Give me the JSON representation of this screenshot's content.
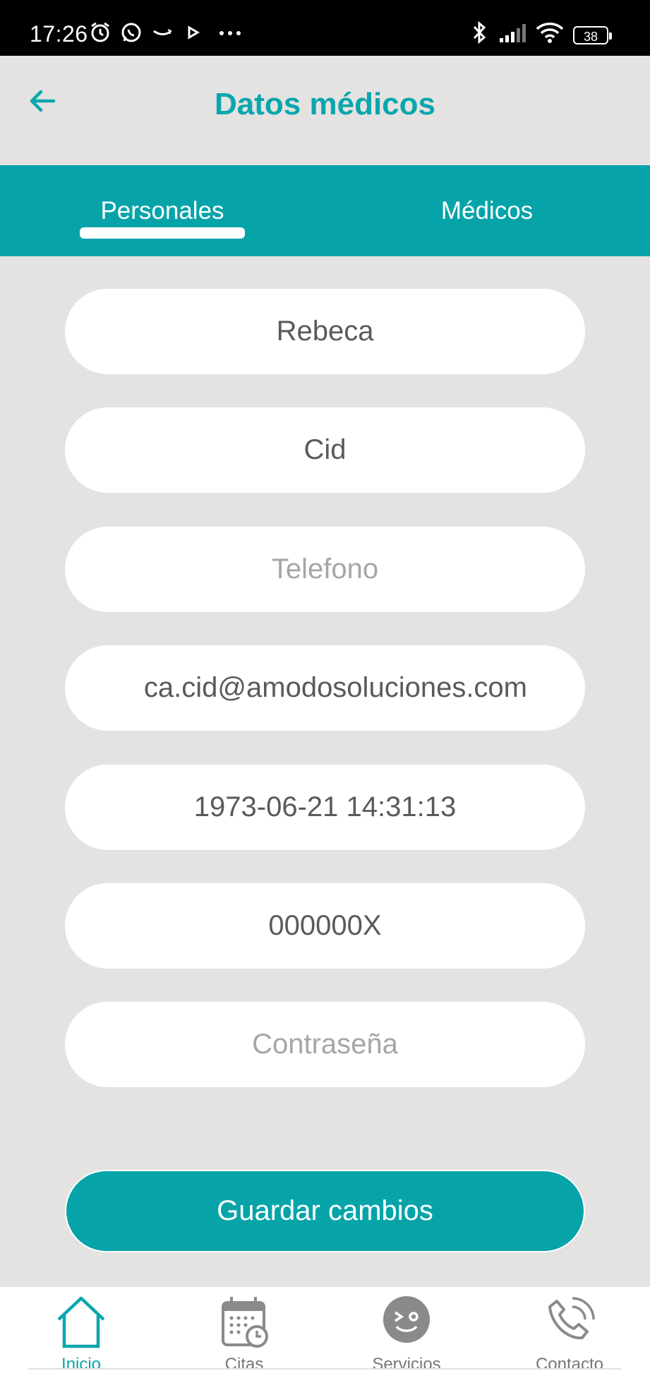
{
  "status_bar": {
    "time": "17:26",
    "battery": "38",
    "left_icons": [
      "alarm-icon",
      "whatsapp-icon",
      "amazon-icon",
      "play-icon",
      "more-dots-icon"
    ],
    "right_icons": [
      "bluetooth-icon",
      "signal-icon",
      "wifi-icon",
      "battery-icon"
    ]
  },
  "header": {
    "title": "Datos médicos"
  },
  "tabs": [
    {
      "label": "Personales",
      "active": true
    },
    {
      "label": "Médicos",
      "active": false
    }
  ],
  "form": {
    "nombre": {
      "value": "Rebeca",
      "placeholder": ""
    },
    "apellido": {
      "value": "Cid",
      "placeholder": ""
    },
    "telefono": {
      "value": "",
      "placeholder": "Telefono"
    },
    "email": {
      "value": "ca.cid@amodosoluciones.com",
      "placeholder": ""
    },
    "fecha": {
      "value": "1973-06-21 14:31:13",
      "placeholder": ""
    },
    "dni": {
      "value": "000000X",
      "placeholder": ""
    },
    "password": {
      "value": "",
      "placeholder": "Contraseña"
    },
    "save_label": "Guardar cambios"
  },
  "bottom_nav": [
    {
      "label": "Inicio",
      "icon": "home-icon",
      "active": true
    },
    {
      "label": "Citas",
      "icon": "calendar-icon",
      "active": false
    },
    {
      "label": "Servicios",
      "icon": "services-icon",
      "active": false
    },
    {
      "label": "Contacto",
      "icon": "phone-icon",
      "active": false
    }
  ],
  "colors": {
    "accent": "#06a4a9",
    "title": "#0aa6ad",
    "background": "#e4e3e2"
  }
}
